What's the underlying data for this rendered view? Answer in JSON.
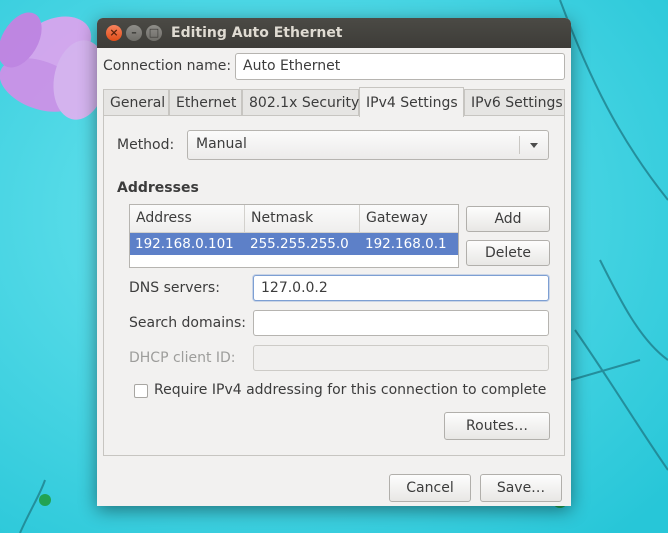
{
  "window": {
    "title": "Editing Auto Ethernet",
    "close_glyph": "×",
    "min_glyph": "–",
    "max_glyph": "□"
  },
  "connection": {
    "label": "Connection name:",
    "value": "Auto Ethernet"
  },
  "tabs": [
    {
      "label": "General"
    },
    {
      "label": "Ethernet"
    },
    {
      "label": "802.1x Security"
    },
    {
      "label": "IPv4 Settings",
      "active": true
    },
    {
      "label": "IPv6 Settings"
    }
  ],
  "method": {
    "label": "Method:",
    "value": "Manual"
  },
  "addresses": {
    "heading": "Addresses",
    "columns": [
      "Address",
      "Netmask",
      "Gateway"
    ],
    "rows": [
      [
        "192.168.0.101",
        "255.255.255.0",
        "192.168.0.1"
      ]
    ],
    "add_label": "Add",
    "delete_label": "Delete"
  },
  "dns": {
    "label": "DNS servers:",
    "value": "127.0.0.2"
  },
  "search": {
    "label": "Search domains:",
    "value": ""
  },
  "dhcp": {
    "label": "DHCP client ID:",
    "value": ""
  },
  "require": {
    "label": "Require IPv4 addressing for this connection to complete",
    "checked": false
  },
  "routes_label": "Routes…",
  "cancel_label": "Cancel",
  "save_label": "Save…",
  "colors": {
    "selection": "#5d80c8",
    "titlebar": "#3d3c38",
    "close_button": "#e04d18",
    "desktop": "#36d7e2"
  }
}
